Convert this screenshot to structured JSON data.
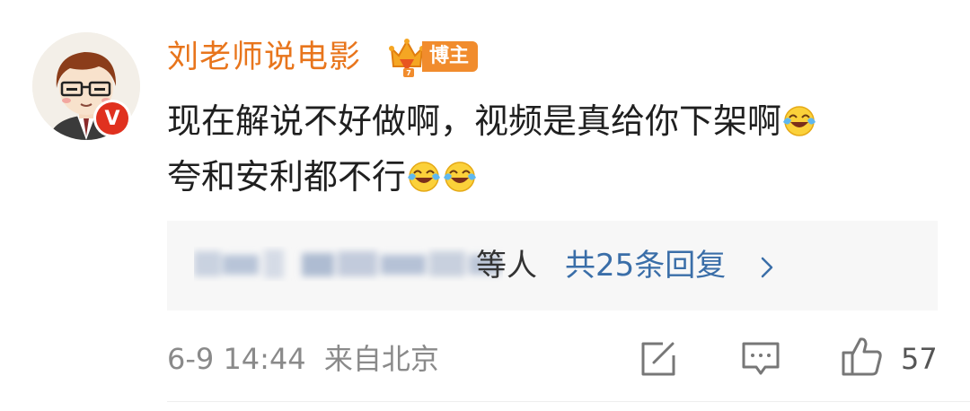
{
  "comment": {
    "username": "刘老师说电影",
    "user_badge": "博主",
    "verified_badge": "V",
    "text_line1": "现在解说不好做啊，视频是真给你下架啊",
    "text_line2": "夸和安利都不行",
    "emoji_name": "laugh-cry"
  },
  "replies": {
    "suffix": "等人",
    "link": "共25条回复",
    "chevron": "›"
  },
  "meta": {
    "timestamp": "6-9 14:44",
    "location": "来自北京",
    "like_count": "57"
  },
  "colors": {
    "username": "#e8751c",
    "badge": "#f18c2d",
    "link": "#3a6ea8",
    "verified": "#e0311f"
  }
}
